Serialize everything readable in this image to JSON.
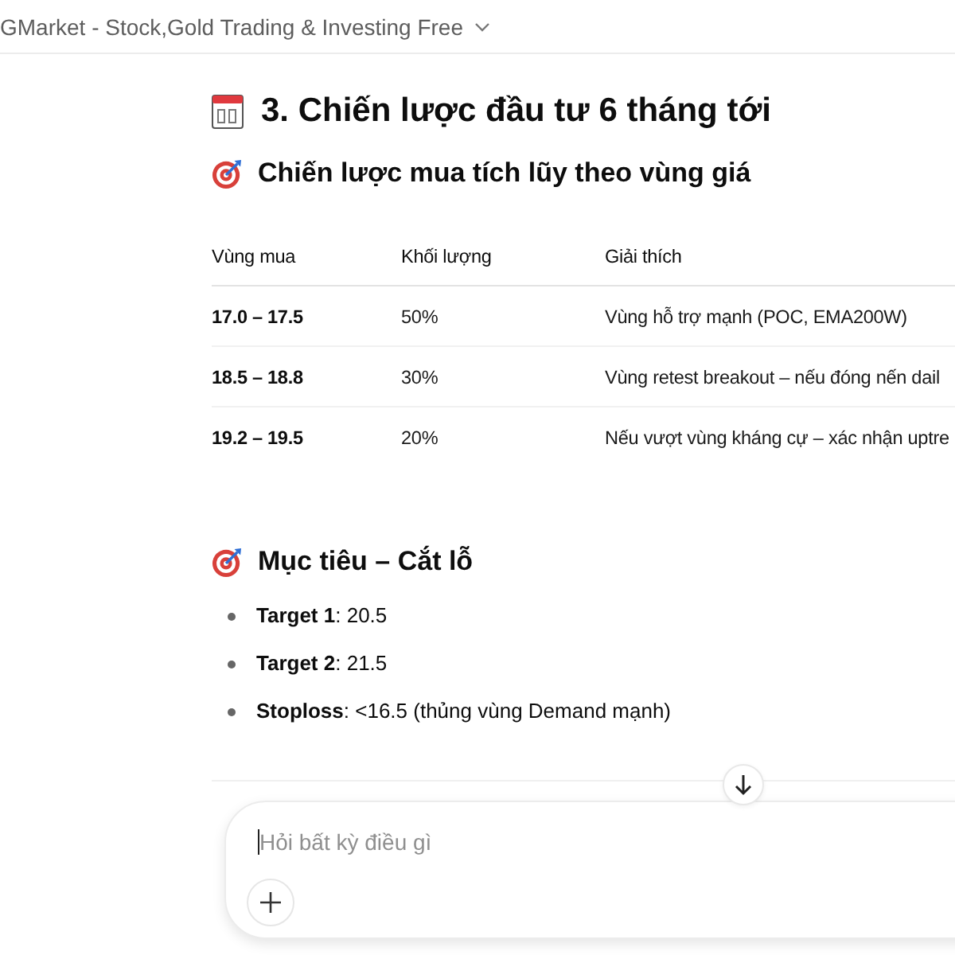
{
  "header": {
    "title": "GMarket - Stock,Gold Trading & Investing Free"
  },
  "article": {
    "heading": "3. Chiến lược đầu tư 6 tháng tới",
    "sections": [
      {
        "kind": "table",
        "title": "Chiến lược mua tích lũy theo vùng giá",
        "table": {
          "columns": [
            "Vùng mua",
            "Khối lượng",
            "Giải thích"
          ],
          "rows": [
            [
              "17.0 – 17.5",
              "50%",
              "Vùng hỗ trợ mạnh (POC, EMA200W)"
            ],
            [
              "18.5 – 18.8",
              "30%",
              "Vùng retest breakout – nếu đóng nến dail"
            ],
            [
              "19.2 – 19.5",
              "20%",
              "Nếu vượt vùng kháng cự – xác nhận uptre"
            ]
          ]
        }
      },
      {
        "kind": "list",
        "title": "Mục tiêu – Cắt lỗ",
        "items": [
          "**Target 1**: 20.5",
          "**Target 2**: 21.5",
          "**Stoploss**: <16.5 (thủng vùng Demand mạnh)"
        ]
      }
    ]
  },
  "composer": {
    "placeholder": "Hỏi bất kỳ điều gì"
  }
}
